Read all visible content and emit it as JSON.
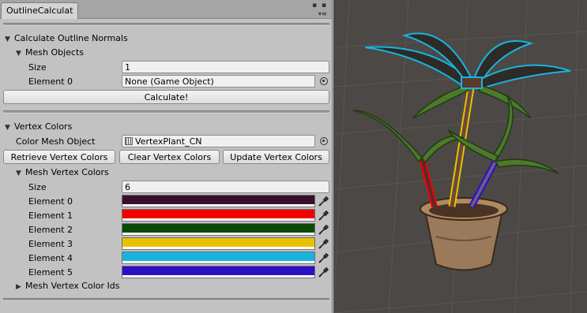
{
  "tab": {
    "title": "OutlineCalculat"
  },
  "outline_section": {
    "header": "Calculate Outline Normals",
    "mesh_objects": {
      "label": "Mesh Objects",
      "size_label": "Size",
      "size_value": "1",
      "element_label": "Element 0",
      "element_value": "None (Game Object)"
    },
    "calculate_button": "Calculate!"
  },
  "vertex_section": {
    "header": "Vertex Colors",
    "color_mesh_label": "Color Mesh Object",
    "color_mesh_value": "VertexPlant_CN",
    "buttons": {
      "retrieve": "Retrieve Vertex Colors",
      "clear": "Clear Vertex Colors",
      "update": "Update Vertex Colors"
    },
    "mesh_vertex_colors": {
      "label": "Mesh Vertex Colors",
      "size_label": "Size",
      "size_value": "6",
      "elements": [
        {
          "label": "Element 0",
          "color": "#3a0f2c"
        },
        {
          "label": "Element 1",
          "color": "#f20000"
        },
        {
          "label": "Element 2",
          "color": "#0a4a08"
        },
        {
          "label": "Element 3",
          "color": "#e8c200"
        },
        {
          "label": "Element 4",
          "color": "#18b4e0"
        },
        {
          "label": "Element 5",
          "color": "#2a0fc4"
        }
      ]
    },
    "color_ids_label": "Mesh Vertex Color Ids"
  },
  "colors": {
    "panel_bg": "#c2c2c2",
    "scene_bg": "#4c4845"
  },
  "icons": {
    "foldout_open": "triangle-down",
    "foldout_closed": "triangle-right",
    "object_picker": "target-circle",
    "color_picker": "eyedropper"
  }
}
